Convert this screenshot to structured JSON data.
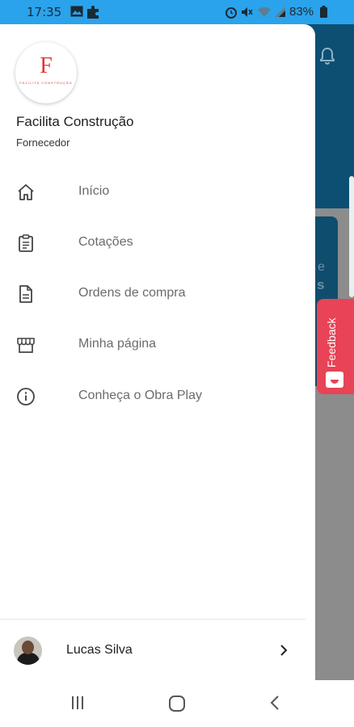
{
  "status_bar": {
    "time": "17:35",
    "battery": "83%",
    "background_color": "#2aa3ec",
    "icons": [
      "image-icon",
      "puzzle-icon",
      "alarm-icon",
      "mute-icon",
      "wifi-icon",
      "signal-icon",
      "battery-icon"
    ]
  },
  "drawer": {
    "company_name": "Facilita Construção",
    "role": "Fornecedor",
    "logo": {
      "letter": "F",
      "tagline": "FACILITA CONSTRUÇÃO",
      "color": "#e2353c"
    },
    "menu": [
      {
        "label": "Início",
        "icon": "home-icon"
      },
      {
        "label": "Cotações",
        "icon": "clipboard-icon"
      },
      {
        "label": "Ordens de compra",
        "icon": "document-icon"
      },
      {
        "label": "Minha página",
        "icon": "store-icon"
      },
      {
        "label": "Conheça o Obra Play",
        "icon": "info-icon"
      }
    ],
    "user": {
      "name": "Lucas Silva",
      "icon": "chevron-right-icon"
    }
  },
  "background_app": {
    "header_color": "#0d4f73",
    "card_text_1": "e",
    "card_text_2": "s"
  },
  "feedback": {
    "label": "Feedback",
    "color": "#e84356"
  },
  "nav_bar": {
    "buttons": [
      "recent-apps-icon",
      "home-button-icon",
      "back-icon"
    ]
  }
}
